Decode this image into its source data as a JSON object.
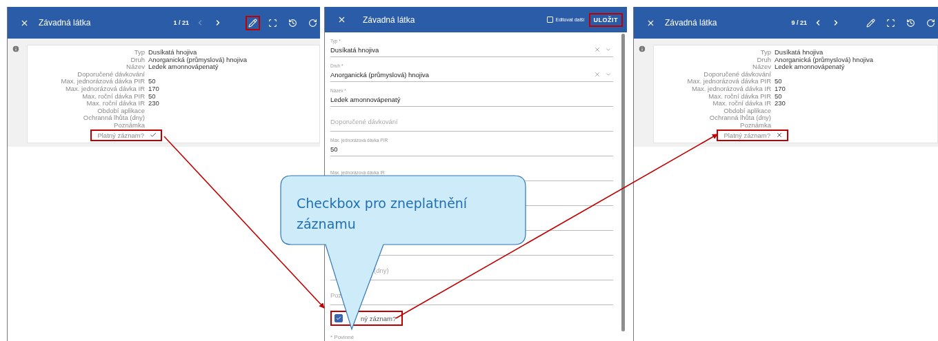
{
  "panels": [
    {
      "kind": "detail",
      "title": "Závadná látka",
      "pager": "1 / 21",
      "prev_disabled": true,
      "tools": [
        {
          "kind": "edit",
          "highlighted": true
        },
        {
          "kind": "fullscreen",
          "highlighted": false
        },
        {
          "kind": "history",
          "highlighted": false
        },
        {
          "kind": "refresh",
          "highlighted": false
        }
      ],
      "rows": [
        {
          "label": "Typ",
          "value": "Dusíkatá hnojiva"
        },
        {
          "label": "Druh",
          "value": "Anorganická (průmyslová) hnojiva"
        },
        {
          "label": "Název",
          "value": "Ledek amonnovápenatý"
        },
        {
          "label": "Doporučené dávkování"
        },
        {
          "label": "Max. jednorázová dávka PIR",
          "value": "50"
        },
        {
          "label": "Max. jednorázová dávka IR",
          "value": "170"
        },
        {
          "label": "Max. roční dávka PIR",
          "value": "50"
        },
        {
          "label": "Max. roční dávka IR",
          "value": "230"
        },
        {
          "label": "Období aplikace"
        },
        {
          "label": "Ochranná lhůta (dny)"
        },
        {
          "label": "Poznámka"
        }
      ],
      "valid": {
        "label": "Platný záznam?",
        "checked": true,
        "highlighted": true
      }
    },
    {
      "kind": "form",
      "title": "Závadná látka",
      "edit_next": {
        "label": "Editovat další",
        "checked": false
      },
      "save": {
        "label": "ULOŽIT",
        "highlighted": true
      },
      "fields": [
        {
          "kind": "select",
          "label": "Typ *",
          "value": "Dusíkatá hnojiva"
        },
        {
          "kind": "select",
          "label": "Druh *",
          "value": "Anorganická (průmyslová) hnojiva"
        },
        {
          "kind": "text",
          "label": "Název *",
          "value": "Ledek amonnovápenatý"
        },
        {
          "kind": "text",
          "placeholder": "Doporučené dávkování"
        },
        {
          "kind": "text",
          "label": "Max. jednorázová dávka PIR",
          "value": "50"
        },
        {
          "kind": "text",
          "label": "Max. jednorázová dávka IR"
        },
        {
          "kind": "text"
        },
        {
          "kind": "text"
        },
        {
          "kind": "text"
        },
        {
          "kind": "text",
          "placeholder": "(dny)",
          "covered": true
        },
        {
          "kind": "text",
          "placeholder": "Poz"
        }
      ],
      "valid": {
        "label": "ný záznam?",
        "checked": true,
        "highlighted": true,
        "covered": true
      },
      "footnote": "* Povinné"
    },
    {
      "kind": "detail",
      "title": "Závadná látka",
      "pager": "9 / 21",
      "prev_disabled": false,
      "tools": [
        {
          "kind": "edit",
          "highlighted": false
        },
        {
          "kind": "fullscreen",
          "highlighted": false
        },
        {
          "kind": "history",
          "highlighted": false
        },
        {
          "kind": "refresh",
          "highlighted": false
        }
      ],
      "rows": [
        {
          "label": "Typ",
          "value": "Dusíkatá hnojiva"
        },
        {
          "label": "Druh",
          "value": "Anorganická (průmyslová) hnojiva"
        },
        {
          "label": "Název",
          "value": "Ledek amonnovápenatý"
        },
        {
          "label": "Doporučené dávkování"
        },
        {
          "label": "Max. jednorázová dávka PIR",
          "value": "50"
        },
        {
          "label": "Max. jednorázová dávka IR",
          "value": "170"
        },
        {
          "label": "Max. roční dávka PIR",
          "value": "50"
        },
        {
          "label": "Max. roční dávka IR",
          "value": "230"
        },
        {
          "label": "Období aplikace"
        },
        {
          "label": "Ochranná lhůta (dny)"
        },
        {
          "label": "Poznámka"
        }
      ],
      "valid": {
        "label": "Platný záznam?",
        "checked": false,
        "highlighted": true
      }
    }
  ],
  "callout": {
    "text": "Checkbox pro zneplatnění záznamu"
  }
}
